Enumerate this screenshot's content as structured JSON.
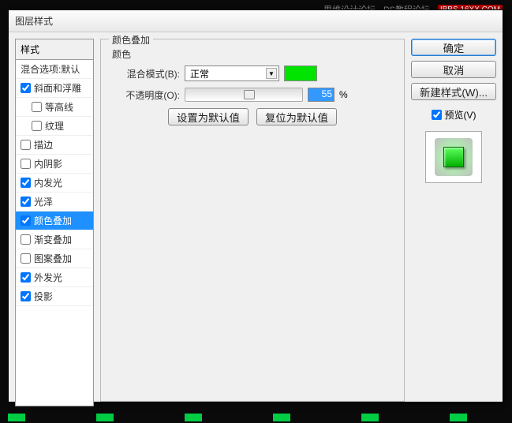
{
  "dialog": {
    "title": "图层样式"
  },
  "watermark": {
    "left": "思维设计论坛",
    "center": "PS教程论坛",
    "right": "IBBS.16XX.COM"
  },
  "styles": {
    "header": "样式",
    "items": [
      {
        "label": "混合选项:默认",
        "checkbox": false,
        "checked": false
      },
      {
        "label": "斜面和浮雕",
        "checkbox": true,
        "checked": true
      },
      {
        "label": "等高线",
        "checkbox": true,
        "checked": false,
        "indent": true
      },
      {
        "label": "纹理",
        "checkbox": true,
        "checked": false,
        "indent": true
      },
      {
        "label": "描边",
        "checkbox": true,
        "checked": false
      },
      {
        "label": "内阴影",
        "checkbox": true,
        "checked": false
      },
      {
        "label": "内发光",
        "checkbox": true,
        "checked": true
      },
      {
        "label": "光泽",
        "checkbox": true,
        "checked": true
      },
      {
        "label": "颜色叠加",
        "checkbox": true,
        "checked": true,
        "selected": true
      },
      {
        "label": "渐变叠加",
        "checkbox": true,
        "checked": false
      },
      {
        "label": "图案叠加",
        "checkbox": true,
        "checked": false
      },
      {
        "label": "外发光",
        "checkbox": true,
        "checked": true
      },
      {
        "label": "投影",
        "checkbox": true,
        "checked": true
      }
    ]
  },
  "center": {
    "title": "颜色叠加",
    "sub": "颜色",
    "blend_label": "混合模式(B):",
    "blend_value": "正常",
    "opacity_label": "不透明度(O):",
    "opacity_value": "55",
    "opacity_unit": "%",
    "btn_default": "设置为默认值",
    "btn_reset": "复位为默认值",
    "swatch_color": "#00e400"
  },
  "right": {
    "ok": "确定",
    "cancel": "取消",
    "new_style": "新建样式(W)...",
    "preview": "预览(V)"
  }
}
